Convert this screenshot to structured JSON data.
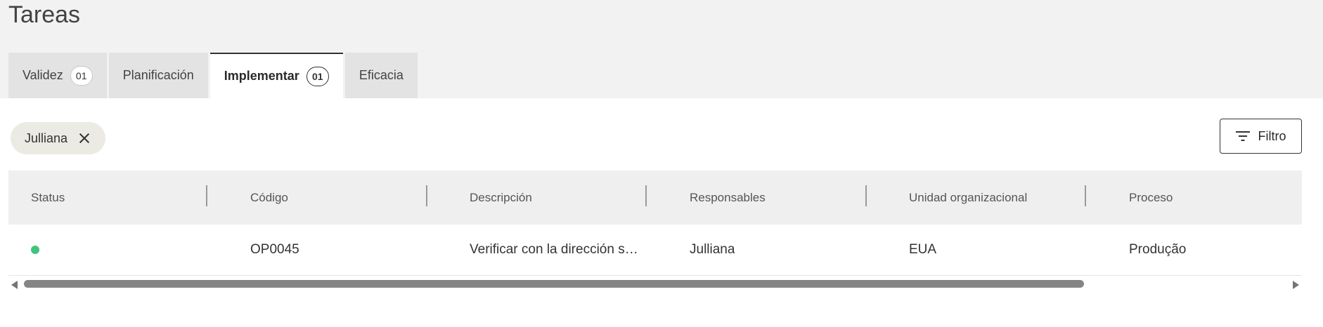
{
  "page": {
    "title": "Tareas"
  },
  "tabs": [
    {
      "label": "Validez",
      "badge": "01",
      "active": false
    },
    {
      "label": "Planificación",
      "badge": "",
      "active": false
    },
    {
      "label": "Implementar",
      "badge": "01",
      "active": true
    },
    {
      "label": "Eficacia",
      "badge": "",
      "active": false
    }
  ],
  "filters": {
    "chip_label": "Julliana",
    "button_label": "Filtro"
  },
  "table": {
    "columns": [
      "Status",
      "Código",
      "Descripción",
      "Responsables",
      "Unidad organizacional",
      "Proceso"
    ],
    "rows": [
      {
        "status": "green",
        "codigo": "OP0045",
        "descripcion": "Verificar con la dirección s…",
        "responsables": "Julliana",
        "unidad": "EUA",
        "proceso": "Produção"
      }
    ]
  },
  "colors": {
    "status_active": "#3fc47e",
    "header_bg": "#f2f2f2",
    "chip_bg": "#ebebe3"
  },
  "icons": {
    "chip_remove": "close-icon",
    "filter": "filter-lines-icon",
    "scroll_left": "arrow-left-icon",
    "scroll_right": "arrow-right-icon"
  }
}
